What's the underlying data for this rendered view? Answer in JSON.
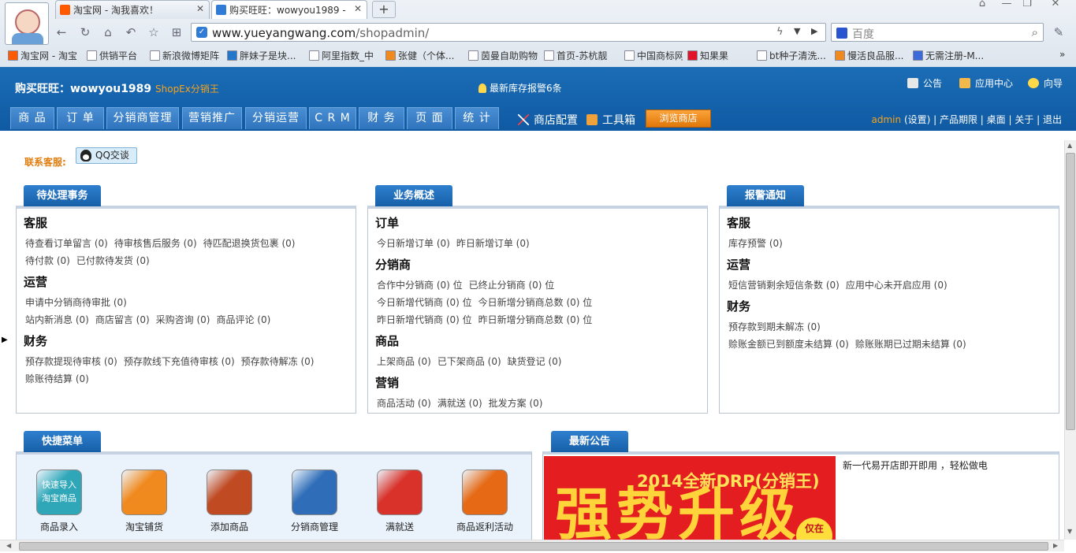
{
  "browser": {
    "tabs": [
      {
        "title": "淘宝网 - 淘我喜欢！"
      },
      {
        "title": "购买旺旺：wowyou1989 -"
      }
    ],
    "url_host": "www.yueyangwang.com",
    "url_path": "/shopadmin/",
    "search_placeholder": "百度",
    "bookmarks": [
      "淘宝网 - 淘宝",
      "供销平台",
      "新浪微博矩阵",
      "胖妹子是块...",
      "阿里指数_中",
      "张健（个体...",
      "茵曼自助购物",
      "首页-苏杭靓",
      "中国商标网...",
      "知果果",
      "bt种子清洗...",
      "慢活良品服...",
      "无需注册-M..."
    ]
  },
  "header": {
    "brand": "购买旺旺：wowyou1989",
    "edition": "ShopEx分销王",
    "stock_alert": "最新库存报警6条",
    "links": {
      "notice": "公告",
      "app_center": "应用中心",
      "guide": "向导"
    },
    "nav_tabs": [
      "商 品",
      "订 单",
      "分销商管理",
      "营销推广",
      "分销运营",
      "C R M",
      "财 务",
      "页 面",
      "统 计"
    ],
    "tools": {
      "shop_config": "商店配置",
      "toolbox": "工具箱"
    },
    "browse_button": "浏览商店",
    "admin": "admin",
    "admin_links": "(设置) | 产品期限 | 桌面 | 关于 | 退出"
  },
  "contact": {
    "label": "联系客服:",
    "qq_button": "QQ交谈"
  },
  "panels": {
    "pending": {
      "title": "待处理事务",
      "sections": [
        {
          "heading": "客服",
          "rows": [
            [
              "待查看订单留言 (0)",
              "待审核售后服务 (0)",
              "待匹配退换货包裹 (0)"
            ],
            [
              "待付款 (0)",
              "已付款待发货 (0)"
            ]
          ]
        },
        {
          "heading": "运营",
          "rows": [
            [
              "申请中分销商待审批 (0)"
            ],
            [
              "站内新消息 (0)",
              "商店留言 (0)",
              "采购咨询 (0)",
              "商品评论 (0)"
            ]
          ]
        },
        {
          "heading": "财务",
          "rows": [
            [
              "预存款提现待审核 (0)",
              "预存款线下充值待审核 (0)",
              "预存款待解冻 (0)"
            ],
            [
              "赊账待结算 (0)"
            ]
          ]
        }
      ]
    },
    "overview": {
      "title": "业务概述",
      "sections": [
        {
          "heading": "订单",
          "rows": [
            [
              "今日新增订单 (0)",
              "昨日新增订单 (0)"
            ]
          ]
        },
        {
          "heading": "分销商",
          "rows": [
            [
              "合作中分销商 (0) 位",
              "已终止分销商 (0) 位"
            ],
            [
              "今日新增代销商 (0) 位",
              "今日新增分销商总数 (0) 位"
            ],
            [
              "昨日新增代销商 (0) 位",
              "昨日新增分销商总数 (0) 位"
            ]
          ]
        },
        {
          "heading": "商品",
          "rows": [
            [
              "上架商品 (0)",
              "已下架商品 (0)",
              "缺货登记 (0)"
            ]
          ]
        },
        {
          "heading": "营销",
          "rows": [
            [
              "商品活动 (0)",
              "满就送 (0)",
              "批发方案 (0)"
            ]
          ]
        }
      ]
    },
    "alerts": {
      "title": "报警通知",
      "sections": [
        {
          "heading": "客服",
          "rows": [
            [
              "库存预警 (0)"
            ]
          ]
        },
        {
          "heading": "运营",
          "rows": [
            [
              "短信营销剩余短信条数 (0)",
              "应用中心未开启应用 (0)"
            ]
          ]
        },
        {
          "heading": "财务",
          "rows": [
            [
              "预存款到期未解冻 (0)"
            ],
            [
              "赊账金额已到额度未结算 (0)",
              "赊账账期已过期未结算 (0)"
            ]
          ]
        }
      ]
    },
    "quick": {
      "title": "快捷菜单",
      "items": [
        {
          "label": "商品录入",
          "icon": "taobao-import-icon",
          "icon_text": "快速导入淘宝商品",
          "color": "#2fa7b9"
        },
        {
          "label": "淘宝铺货",
          "icon": "taobao-distribute-icon",
          "icon_text": "",
          "color": "#f08a1e"
        },
        {
          "label": "添加商品",
          "icon": "add-product-icon",
          "icon_text": "",
          "color": "#c04a22"
        },
        {
          "label": "分销商管理",
          "icon": "distributor-manage-icon",
          "icon_text": "",
          "color": "#2f6db8"
        },
        {
          "label": "满就送",
          "icon": "gift-icon",
          "icon_text": "",
          "color": "#d8322a"
        },
        {
          "label": "商品返利活动",
          "icon": "rebate-smile-icon",
          "icon_text": "",
          "color": "#e66a16"
        }
      ]
    },
    "news": {
      "title": "最新公告",
      "banner_line1": "2014全新DRP(分销王)",
      "banner_line2": "强势升级",
      "banner_badge": "仅在",
      "headline": "新一代易开店即开即用 ，轻松做电"
    }
  }
}
